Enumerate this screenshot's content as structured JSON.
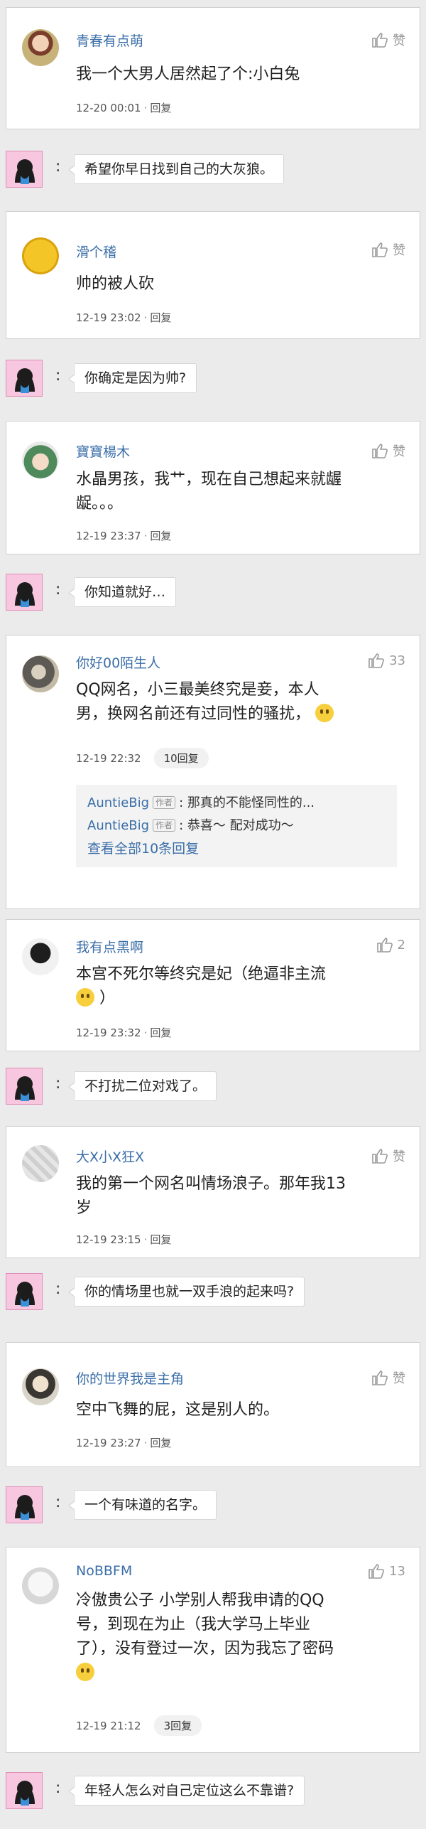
{
  "like_label": "赞",
  "reply_label": "回复",
  "comments": [
    {
      "name": "青春有点萌",
      "like": "赞",
      "content": "我一个大男人居然起了个:小白兔",
      "time": "12-20 00:01",
      "reply": "回复",
      "author_reply": "希望你早日找到自己的大灰狼。"
    },
    {
      "name": "滑个稽",
      "like": "赞",
      "content": "帅的被人砍",
      "time": "12-19 23:02",
      "reply": "回复",
      "author_reply": "你确定是因为帅?"
    },
    {
      "name": "寶寶楊木",
      "like": "赞",
      "content_line1": "水晶男孩，我艹，现在自己想起来就龌",
      "content_line2": "龊。。。",
      "time": "12-19 23:37",
      "reply": "回复",
      "author_reply": "你知道就好…"
    },
    {
      "name": "你好00陌生人",
      "like": "33",
      "content_line1": "QQ网名，小三最美终究是妾，本人",
      "content_line2": "男，换网名前还有过同性的骚扰，",
      "time": "12-19 22:32",
      "replies_count": "10回复",
      "sub_replies": [
        {
          "user": "AuntieBig",
          "tag": "作者",
          "text": "那真的不能怪同性的..."
        },
        {
          "user": "AuntieBig",
          "tag": "作者",
          "text": "恭喜～ 配对成功～"
        }
      ],
      "see_all": "查看全部10条回复"
    },
    {
      "name": "我有点黑啊",
      "like": "2",
      "content_line1": "本宫不死尔等终究是妃（绝逼非主流",
      "content_line2": "）",
      "time": "12-19 23:32",
      "reply": "回复",
      "author_reply": "不打扰二位对戏了。"
    },
    {
      "name": "大X小X狂X",
      "like": "赞",
      "content_line1": "我的第一个网名叫情场浪子。那年我13",
      "content_line2": "岁",
      "time": "12-19 23:15",
      "reply": "回复",
      "author_reply": "你的情场里也就一双手浪的起来吗?"
    },
    {
      "name": "你的世界我是主角",
      "like": "赞",
      "content": "空中飞舞的屁，这是别人的。",
      "time": "12-19 23:27",
      "reply": "回复",
      "author_reply": "一个有味道的名字。"
    },
    {
      "name": "NoBBFM",
      "like": "13",
      "content_line1": "冷傲贵公子 小学别人帮我申请的QQ",
      "content_line2": "号，到现在为止（我大学马上毕业",
      "content_line3": "了），没有登过一次，因为我忘了密码",
      "time": "12-19 21:12",
      "replies_count": "3回复",
      "author_reply": "年轻人怎么对自己定位这么不靠谱?"
    }
  ],
  "colon": ":"
}
